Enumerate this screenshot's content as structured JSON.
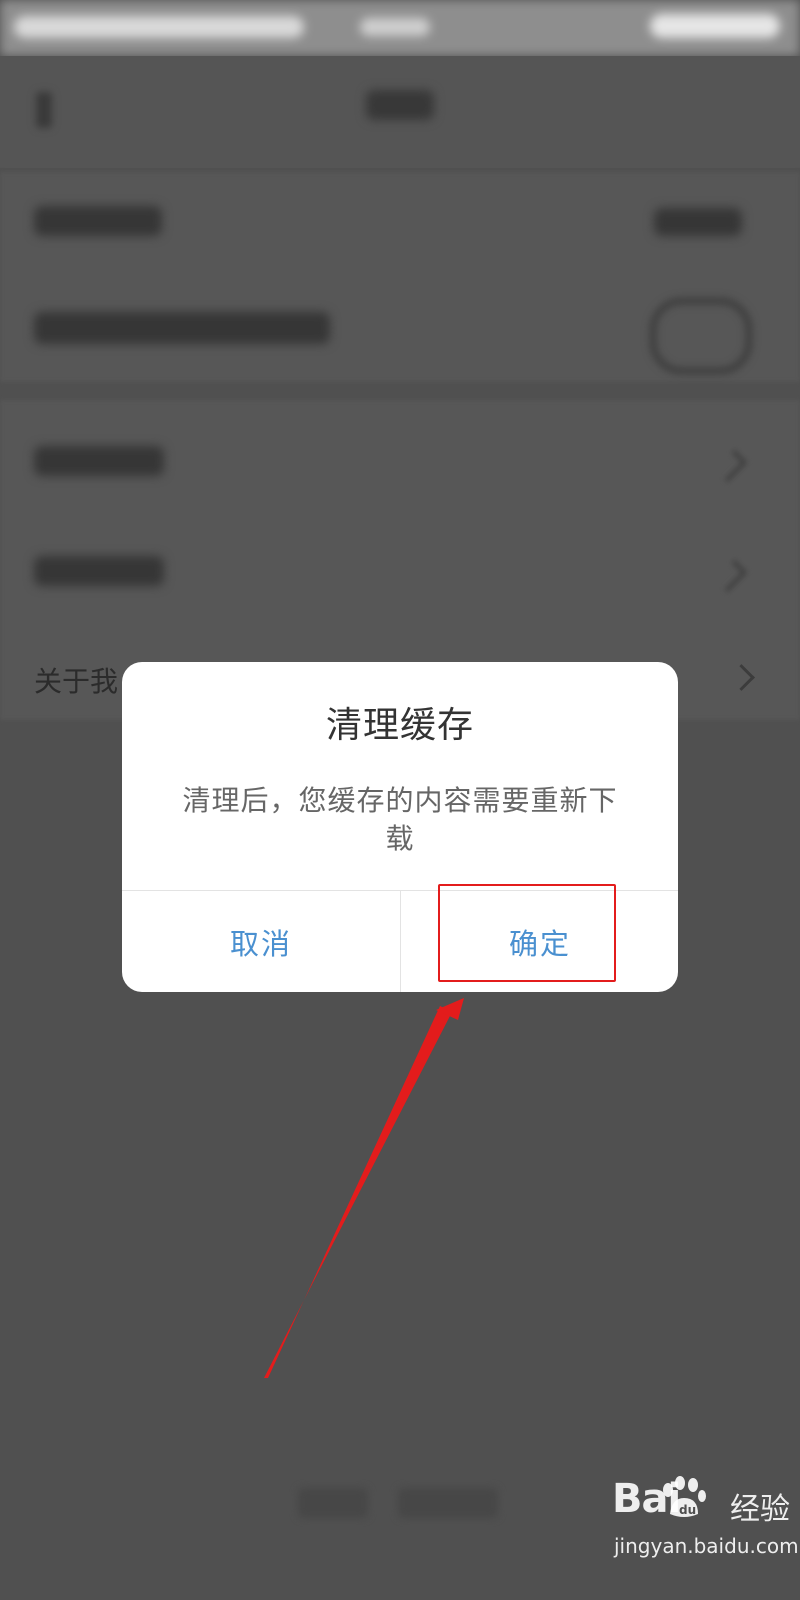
{
  "background": {
    "about_row_label": "关于我"
  },
  "dialog": {
    "title": "清理缓存",
    "message": "清理后，您缓存的内容需要重新下载",
    "cancel_label": "取消",
    "confirm_label": "确定"
  },
  "annotation": {
    "highlight_color": "#e31c1c",
    "arrow_color": "#e31c1c",
    "target": "confirm-button"
  },
  "watermark": {
    "logo_text": "Bai",
    "logo_suffix": "经验",
    "url": "jingyan.baidu.com"
  },
  "colors": {
    "dialog_button_text": "#4a90d0",
    "overlay_background": "#505050"
  }
}
